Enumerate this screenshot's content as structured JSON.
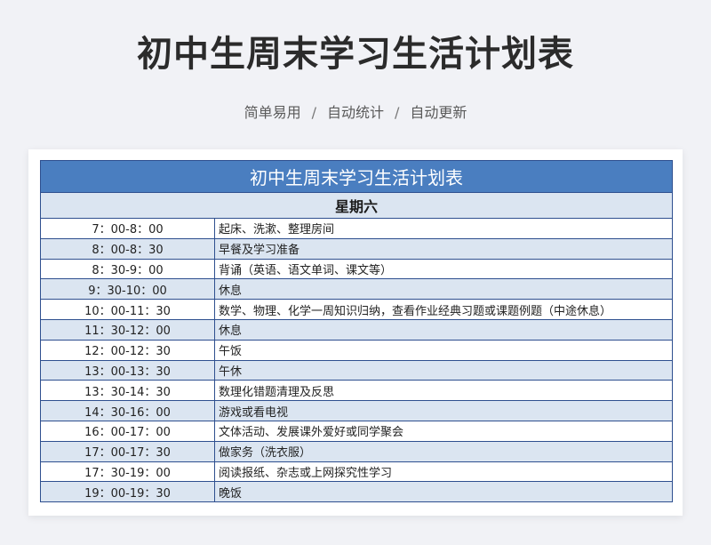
{
  "page": {
    "title": "初中生周末学习生活计划表",
    "subtitle": [
      "简单易用",
      "自动统计",
      "自动更新"
    ],
    "separator": "/"
  },
  "table": {
    "title": "初中生周末学习生活计划表",
    "day": "星期六",
    "rows": [
      {
        "time": "7：00-8：00",
        "activity": "起床、洗漱、整理房间"
      },
      {
        "time": "8：00-8：30",
        "activity": "早餐及学习准备"
      },
      {
        "time": "8：30-9：00",
        "activity": "背诵（英语、语文单词、课文等）"
      },
      {
        "time": "9：30-10：00",
        "activity": "休息"
      },
      {
        "time": "10：00-11：30",
        "activity": "数学、物理、化学一周知识归纳，查看作业经典习题或课题例题（中途休息）"
      },
      {
        "time": "11：30-12：00",
        "activity": "休息"
      },
      {
        "time": "12：00-12：30",
        "activity": "午饭"
      },
      {
        "time": "13：00-13：30",
        "activity": "午休"
      },
      {
        "time": "13：30-14：30",
        "activity": "数理化错题清理及反思"
      },
      {
        "time": "14：30-16：00",
        "activity": "游戏或看电视"
      },
      {
        "time": "16：00-17：00",
        "activity": "文体活动、发展课外爱好或同学聚会"
      },
      {
        "time": "17：00-17：30",
        "activity": "做家务（洗衣服）"
      },
      {
        "time": "17：30-19：00",
        "activity": "阅读报纸、杂志或上网探究性学习"
      },
      {
        "time": "19：00-19：30",
        "activity": "晚饭"
      }
    ]
  },
  "colors": {
    "header_bg": "#4a7ec0",
    "alt_row_bg": "#dbe5f1",
    "border": "#2e4f8f"
  }
}
